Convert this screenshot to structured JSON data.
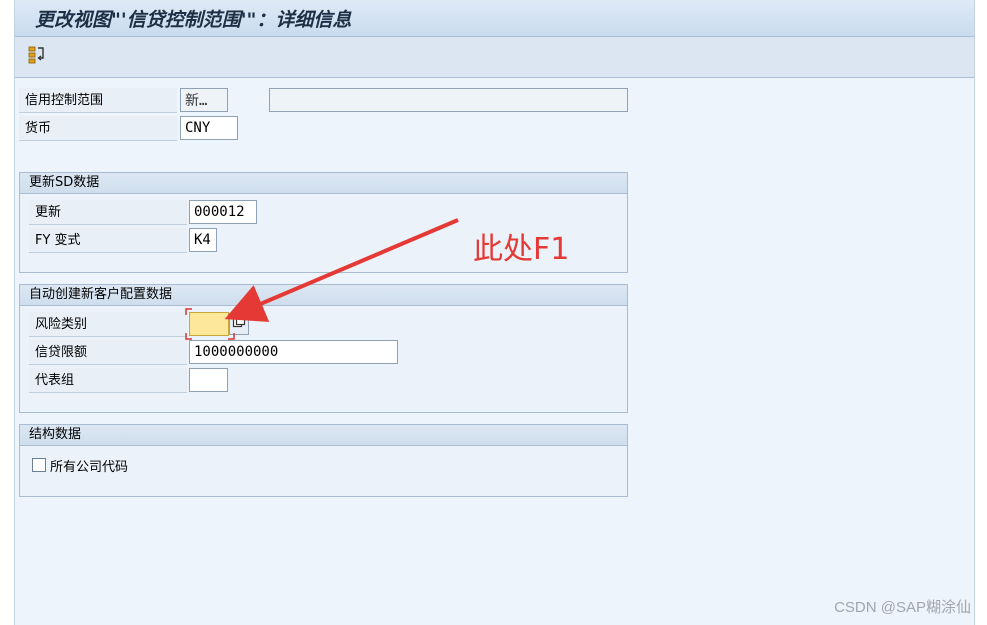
{
  "window": {
    "title": "更改视图\"'信贷控制范围'\"：详细信息"
  },
  "toolbar": {
    "toggle_icon": "display-change-icon"
  },
  "header": {
    "credit_area_label": "信用控制范围",
    "credit_area_value": "新…",
    "credit_area_desc": "",
    "currency_label": "货币",
    "currency_value": "CNY"
  },
  "sd_update": {
    "title": "更新SD数据",
    "update_label": "更新",
    "update_value": "000012",
    "fy_label": "FY 变式",
    "fy_value": "K4"
  },
  "auto_create": {
    "title": "自动创建新客户配置数据",
    "risk_label": "风险类别",
    "risk_value": "",
    "limit_label": "信贷限额",
    "limit_value": "1000000000",
    "rep_group_label": "代表组",
    "rep_group_value": ""
  },
  "org_data": {
    "title": "结构数据",
    "all_company_codes_label": "所有公司代码",
    "all_company_codes_checked": false
  },
  "annotation": {
    "text": "此处F1",
    "color": "#e53935"
  },
  "watermark": {
    "text": "CSDN @SAP糊涂仙"
  },
  "colors": {
    "focus_field": "#fde79a",
    "annotation": "#e53935"
  }
}
